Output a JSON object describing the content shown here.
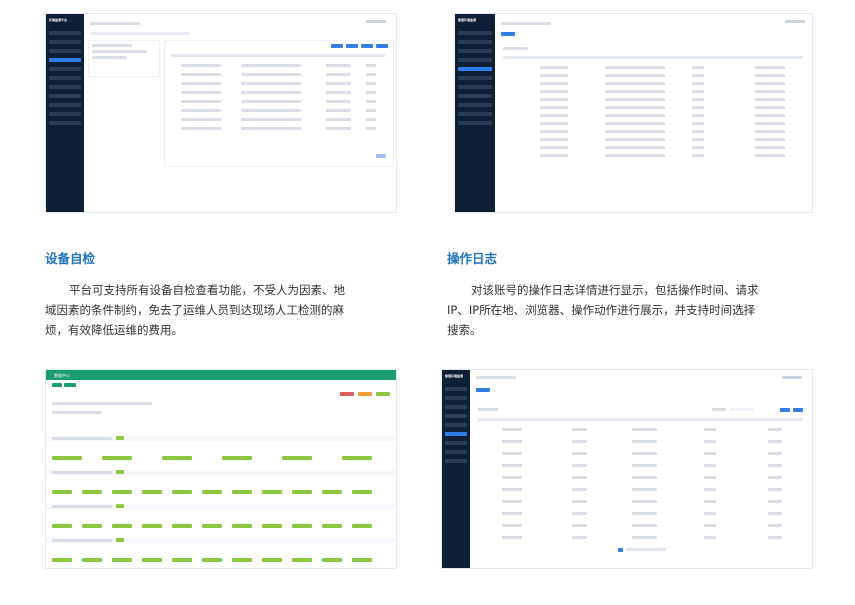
{
  "sections": [
    {
      "title": "设备自检",
      "lines": [
        "平台可支持所有设备自检查看功能，不受人为因素、地",
        "域因素的条件制约，免去了运维人员到达现场人工检测的麻",
        "烦，有效降低运维的费用。"
      ]
    },
    {
      "title": "操作日志",
      "lines": [
        "对该账号的操作日志详情进行显示，包括操作时间、请求",
        "IP、IP所在地、浏览器、操作动作进行展示，并支持时间选择",
        "搜索。"
      ]
    }
  ],
  "screenshots": {
    "s1": {
      "logo": "环境监测平台"
    },
    "s2": {
      "logo": "智慧环境监测"
    },
    "s3": {
      "header": "数据中心"
    },
    "s4": {
      "logo": "智慧环境监测"
    }
  }
}
